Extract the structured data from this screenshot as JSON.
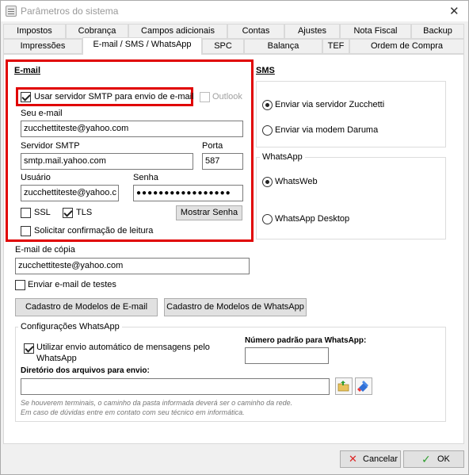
{
  "window": {
    "title": "Parâmetros do sistema"
  },
  "tabs_row1": [
    "Impostos",
    "Cobrança",
    "Campos adicionais",
    "Contas",
    "Ajustes",
    "Nota Fiscal",
    "Backup"
  ],
  "tabs_row2": [
    "Impressões",
    "E-mail / SMS / WhatsApp",
    "SPC",
    "Balança",
    "TEF",
    "Ordem de Compra"
  ],
  "email": {
    "section_title": "E-mail",
    "use_smtp_label": "Usar servidor SMTP para envio de e-mail",
    "use_smtp_checked": true,
    "outlook_label": "Outlook",
    "outlook_checked": false,
    "your_email_label": "Seu e-mail",
    "your_email_value": "zucchettiteste@yahoo.com",
    "smtp_label": "Servidor SMTP",
    "smtp_value": "smtp.mail.yahoo.com",
    "port_label": "Porta",
    "port_value": "587",
    "user_label": "Usuário",
    "user_value": "zucchettiteste@yahoo.c",
    "password_label": "Senha",
    "password_value": "●●●●●●●●●●●●●●●●●",
    "ssl_label": "SSL",
    "ssl_checked": false,
    "tls_label": "TLS",
    "tls_checked": true,
    "show_password_label": "Mostrar Senha",
    "read_confirm_label": "Solicitar confirmação de leitura",
    "read_confirm_checked": false
  },
  "copy_email": {
    "label": "E-mail de cópia",
    "value": "zucchettiteste@yahoo.com",
    "send_test_label": "Enviar e-mail de testes",
    "send_test_checked": false
  },
  "buttons": {
    "email_templates": "Cadastro de Modelos de E-mail",
    "whatsapp_templates": "Cadastro de Modelos de WhatsApp",
    "cancel": "Cancelar",
    "ok": "OK"
  },
  "sms": {
    "section_title": "SMS",
    "option_zucchetti": "Enviar via servidor Zucchetti",
    "option_daruma": "Enviar via modem Daruma",
    "selected": "zucchetti"
  },
  "whatsapp": {
    "group_title": "WhatsApp",
    "option_web": "WhatsWeb",
    "option_desktop": "WhatsApp Desktop",
    "selected": "web"
  },
  "whatsapp_config": {
    "group_title": "Configurações WhatsApp",
    "auto_send_label": "Utilizar envio automático de mensagens pelo WhatsApp",
    "auto_send_checked": true,
    "default_number_label": "Número padrão para WhatsApp:",
    "default_number_value": "",
    "directory_label": "Diretório dos arquivos para envio:",
    "directory_value": "",
    "hint_line1": "Se houverem terminais, o caminho da pasta informada deverá ser o caminho da rede.",
    "hint_line2": "Em caso de dúvidas entre em contato com seu técnico em informática."
  },
  "colors": {
    "highlight": "#e00000",
    "ok_check": "#2e9e2e",
    "cancel_x": "#d22"
  }
}
